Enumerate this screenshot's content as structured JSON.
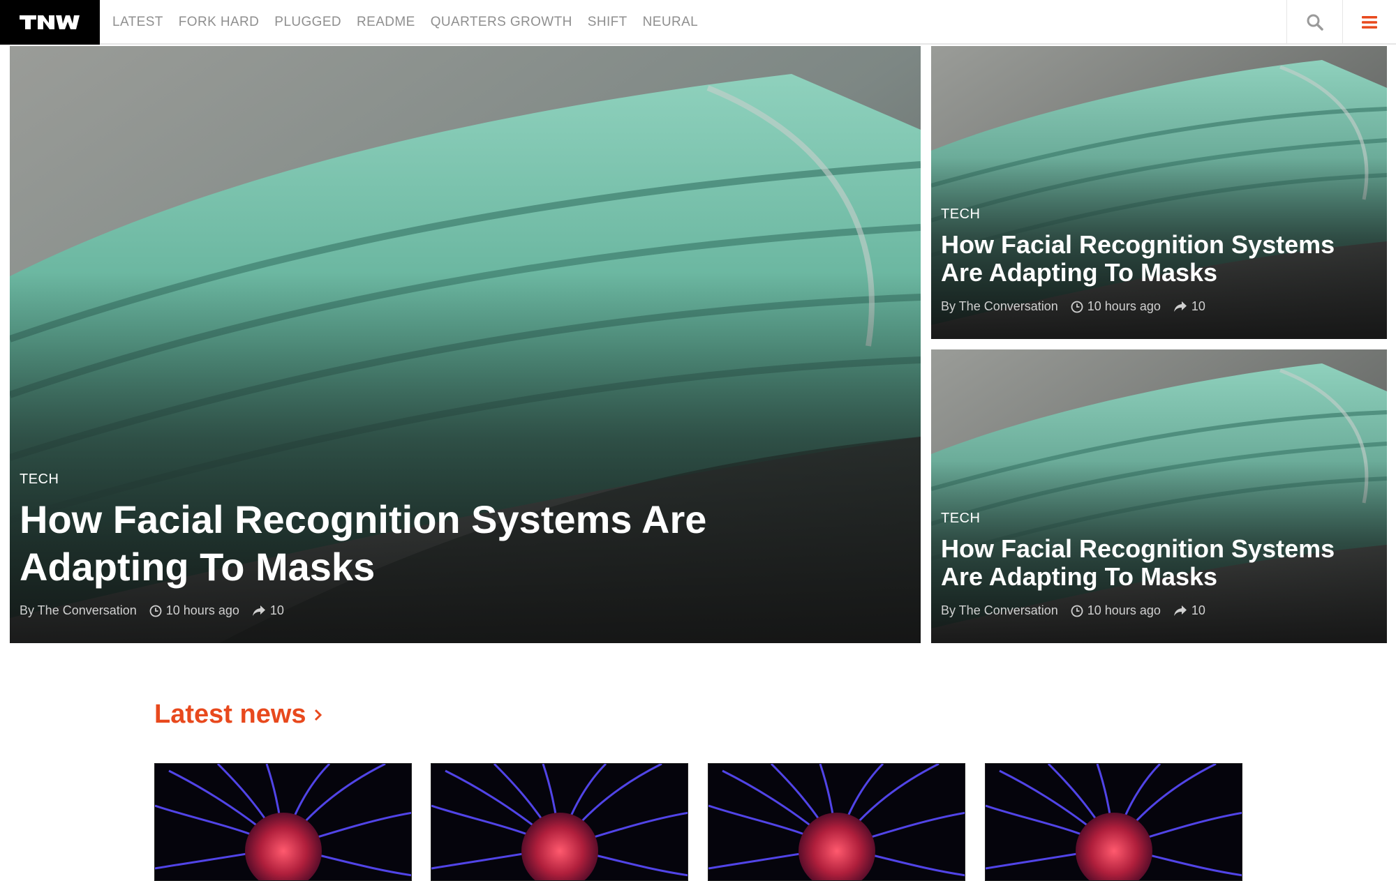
{
  "logo": {
    "text": "TNW"
  },
  "nav": {
    "items": [
      "LATEST",
      "FORK HARD",
      "PLUGGED",
      "README",
      "QUARTERS GROWTH",
      "SHIFT",
      "NEURAL"
    ]
  },
  "toolbar": {
    "search_icon": "search-icon",
    "menu_icon": "hamburger-menu-icon"
  },
  "colors": {
    "accent": "#e8491d",
    "nav_text": "#8f8f8f",
    "mask_teal": "#6fb8a3"
  },
  "hero": {
    "main": {
      "tag": "TECH",
      "title": "How Facial Recognition Systems Are Adapting To Masks",
      "author": "By The Conversation",
      "time": "10 hours ago",
      "shares": "10"
    },
    "side": [
      {
        "tag": "TECH",
        "title": "How Facial Recognition Systems Are Adapting To Masks",
        "author": "By The Conversation",
        "time": "10 hours ago",
        "shares": "10"
      },
      {
        "tag": "TECH",
        "title": "How Facial Recognition Systems Are Adapting To Masks",
        "author": "By The Conversation",
        "time": "10 hours ago",
        "shares": "10"
      }
    ]
  },
  "latest": {
    "title": "Latest news"
  }
}
